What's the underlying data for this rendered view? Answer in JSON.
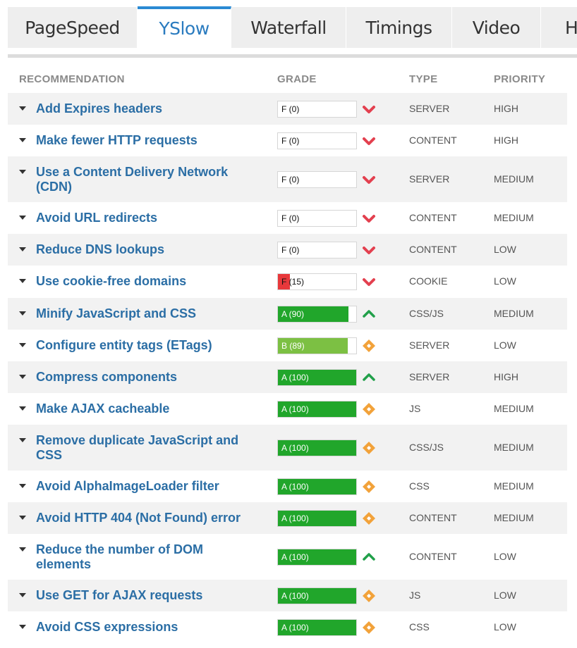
{
  "tabs": [
    {
      "label": "PageSpeed",
      "active": false
    },
    {
      "label": "YSlow",
      "active": true
    },
    {
      "label": "Waterfall",
      "active": false
    },
    {
      "label": "Timings",
      "active": false
    },
    {
      "label": "Video",
      "active": false
    },
    {
      "label": "H",
      "active": false
    }
  ],
  "table": {
    "headers": {
      "recommendation": "RECOMMENDATION",
      "grade": "GRADE",
      "type": "TYPE",
      "priority": "PRIORITY"
    },
    "rows": [
      {
        "recommendation": "Add Expires headers",
        "grade": "F (0)",
        "score": 0,
        "trend": "down",
        "type": "SERVER",
        "priority": "HIGH"
      },
      {
        "recommendation": "Make fewer HTTP requests",
        "grade": "F (0)",
        "score": 0,
        "trend": "down",
        "type": "CONTENT",
        "priority": "HIGH"
      },
      {
        "recommendation": "Use a Content Delivery Network (CDN)",
        "grade": "F (0)",
        "score": 0,
        "trend": "down",
        "type": "SERVER",
        "priority": "MEDIUM"
      },
      {
        "recommendation": "Avoid URL redirects",
        "grade": "F (0)",
        "score": 0,
        "trend": "down",
        "type": "CONTENT",
        "priority": "MEDIUM"
      },
      {
        "recommendation": "Reduce DNS lookups",
        "grade": "F (0)",
        "score": 0,
        "trend": "down",
        "type": "CONTENT",
        "priority": "LOW"
      },
      {
        "recommendation": "Use cookie-free domains",
        "grade": "F (15)",
        "score": 15,
        "trend": "down",
        "type": "COOKIE",
        "priority": "LOW"
      },
      {
        "recommendation": "Minify JavaScript and CSS",
        "grade": "A (90)",
        "score": 90,
        "trend": "up",
        "type": "CSS/JS",
        "priority": "MEDIUM"
      },
      {
        "recommendation": "Configure entity tags (ETags)",
        "grade": "B (89)",
        "score": 89,
        "trend": "neutral",
        "type": "SERVER",
        "priority": "LOW"
      },
      {
        "recommendation": "Compress components",
        "grade": "A (100)",
        "score": 100,
        "trend": "up",
        "type": "SERVER",
        "priority": "HIGH"
      },
      {
        "recommendation": "Make AJAX cacheable",
        "grade": "A (100)",
        "score": 100,
        "trend": "neutral",
        "type": "JS",
        "priority": "MEDIUM"
      },
      {
        "recommendation": "Remove duplicate JavaScript and CSS",
        "grade": "A (100)",
        "score": 100,
        "trend": "neutral",
        "type": "CSS/JS",
        "priority": "MEDIUM"
      },
      {
        "recommendation": "Avoid AlphaImageLoader filter",
        "grade": "A (100)",
        "score": 100,
        "trend": "neutral",
        "type": "CSS",
        "priority": "MEDIUM"
      },
      {
        "recommendation": "Avoid HTTP 404 (Not Found) error",
        "grade": "A (100)",
        "score": 100,
        "trend": "neutral",
        "type": "CONTENT",
        "priority": "MEDIUM"
      },
      {
        "recommendation": "Reduce the number of DOM elements",
        "grade": "A (100)",
        "score": 100,
        "trend": "up",
        "type": "CONTENT",
        "priority": "LOW"
      },
      {
        "recommendation": "Use GET for AJAX requests",
        "grade": "A (100)",
        "score": 100,
        "trend": "neutral",
        "type": "JS",
        "priority": "LOW"
      },
      {
        "recommendation": "Avoid CSS expressions",
        "grade": "A (100)",
        "score": 100,
        "trend": "neutral",
        "type": "CSS",
        "priority": "LOW"
      }
    ]
  },
  "colors": {
    "link": "#2b6ea5",
    "tab_active": "#2a7bbf",
    "grade_red": "#e8383b",
    "grade_green": "#21a62b",
    "grade_lightgreen": "#7cc043",
    "trend_down": "#e3404f",
    "trend_up": "#21a04a",
    "trend_neutral": "#f2a23a"
  },
  "icons": {
    "down": "chevron-down-icon",
    "up": "chevron-up-icon",
    "neutral": "diamond-icon"
  }
}
